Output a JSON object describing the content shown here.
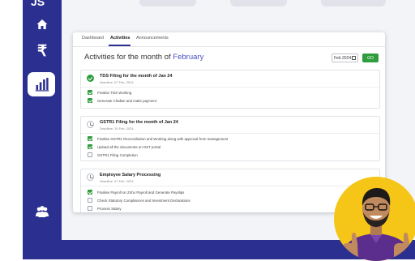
{
  "sidebar": {
    "logo": "JS",
    "items": [
      {
        "icon": "home-icon"
      },
      {
        "icon": "rupee-icon"
      },
      {
        "icon": "bar-chart-icon",
        "active": true
      },
      {
        "icon": "users-icon"
      }
    ]
  },
  "tabs": [
    "Dashboard",
    "Activities",
    "Announcements"
  ],
  "active_tab": "Activities",
  "heading": {
    "prefix": "Activities for the month of",
    "month": "February"
  },
  "filter": {
    "date_value": "Feb 2024",
    "go_label": "GO"
  },
  "sections": [
    {
      "title": "TDS Filing for the month of Jan 24",
      "deadline": "Deadline: 07 Feb, 2024",
      "status": "done",
      "tasks": [
        {
          "label": "Finalise TDS Working",
          "checked": true
        },
        {
          "label": "Generate Challan and make payment",
          "checked": true
        }
      ]
    },
    {
      "title": "GSTR1 Filing for the month of Jan 24",
      "deadline": "Deadline: 15 Feb, 2024",
      "status": "pending",
      "tasks": [
        {
          "label": "Finalise GSTR1 Reconciliation and Working along with approval from management",
          "checked": true
        },
        {
          "label": "Upload all the documents on GST portal",
          "checked": true
        },
        {
          "label": "GSTR1 Filing Completion",
          "checked": false
        }
      ]
    },
    {
      "title": "Employee Salary Processing",
      "deadline": "Deadline: 07 Feb, 2024",
      "status": "pending",
      "tasks": [
        {
          "label": "Finalise Payroll on Zoho Payroll and Generate Payslips",
          "checked": true
        },
        {
          "label": "Check Statutory Compliances and Investment Declarations",
          "checked": false
        },
        {
          "label": "Process Salary",
          "checked": false
        }
      ]
    }
  ],
  "colors": {
    "sidebar": "#2b2f8f",
    "accent": "#4a4fc8",
    "success": "#2f9d3e",
    "avatar_bg": "#f5c518"
  }
}
